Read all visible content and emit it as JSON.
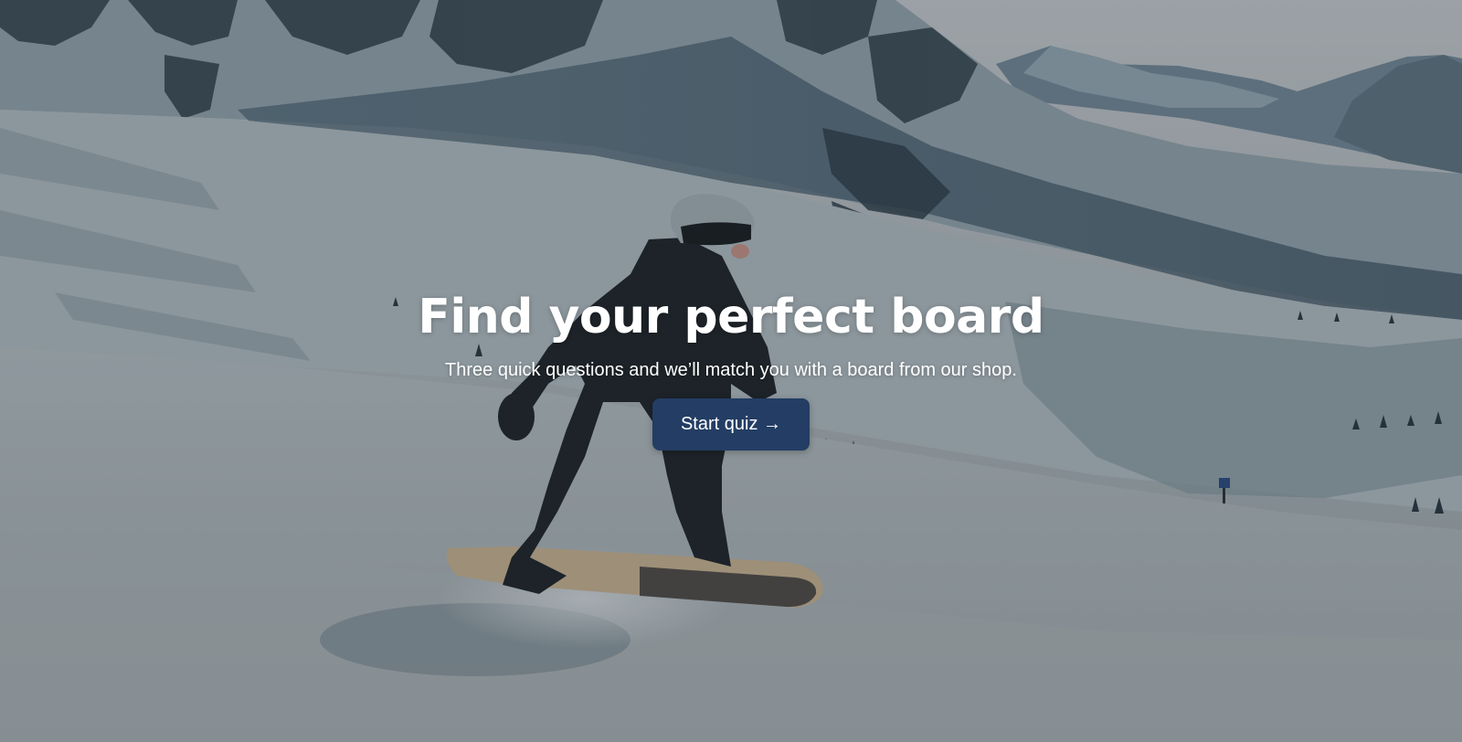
{
  "hero": {
    "title": "Find your perfect board",
    "subtitle": "Three quick questions and we’ll match you with a board from our shop.",
    "cta_label": "Start quiz →",
    "background_image": "snowboarder-on-mountain-slope",
    "cta_color": "#233d64"
  }
}
